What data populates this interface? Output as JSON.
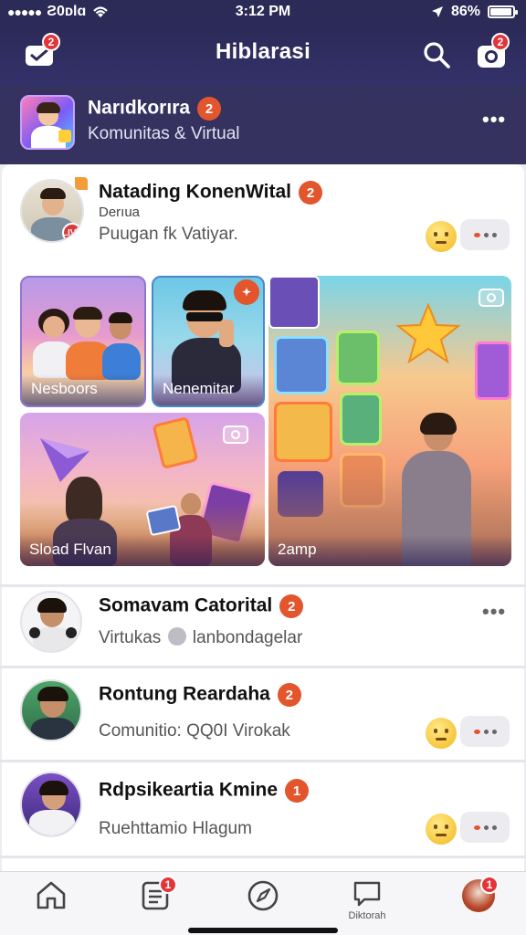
{
  "status_bar": {
    "carrier": "Ƨ0ᴅlɑ",
    "time": "3:12 PM",
    "battery_text": "86%",
    "battery_level": 0.86
  },
  "header": {
    "title": "Hiblarasi",
    "inbox_badge": "2",
    "camera_badge": "2"
  },
  "community": {
    "name": "Narıdkorıra",
    "count": "2",
    "subtitle": "Komunitas & Virtual",
    "more": "•••"
  },
  "post": {
    "author": "Natading KonenWital",
    "count": "2",
    "meta": "Derıua",
    "subtitle": "Puugan fk Vatiyar.",
    "live_badge": "LIVE",
    "tiles": [
      {
        "label": "Nesboors"
      },
      {
        "label": "Nenemitar"
      },
      {
        "label": "Sload Flvan"
      },
      {
        "label": "2amp"
      }
    ]
  },
  "items": [
    {
      "name": "Somavam Catorital",
      "count": "2",
      "subtitle": "Virtukas",
      "subtitle2": "lanbondagelar"
    },
    {
      "name": "Rontung Reardaha",
      "count": "2",
      "subtitle": "Comunitio: QQ0I Virokak"
    },
    {
      "name": "Rdpsikeartia Kmine",
      "count": "1",
      "subtitle": "Ruehttamio Hlagum"
    }
  ],
  "tabbar": {
    "notes_badge": "1",
    "profile_badge": "1",
    "discover_label": "Diktorah"
  },
  "colors": {
    "header_bg": "#2c2a57",
    "accent_orange": "#e2552d",
    "badge_red": "#e3343a"
  }
}
